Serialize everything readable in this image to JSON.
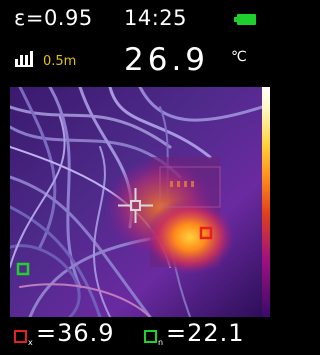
{
  "status": {
    "emissivity": "ε=0.95",
    "clock": "14:25",
    "battery_icon": "battery-full-icon",
    "battery_color": "#1ecf2e"
  },
  "measure": {
    "distance": "0.5m",
    "distance_color": "#e5c100",
    "center_temp": "26.9",
    "unit": "℃"
  },
  "readouts": {
    "max_sub": "x",
    "max_value": "=36.9",
    "max_color": "#e52020",
    "min_sub": "n",
    "min_value": "=22.1",
    "min_color": "#22d02c"
  },
  "colorbar_colors": [
    "#ffffff",
    "#ffd23c",
    "#ff8a1c",
    "#e0401c",
    "#a01080",
    "#3a0a6a"
  ]
}
